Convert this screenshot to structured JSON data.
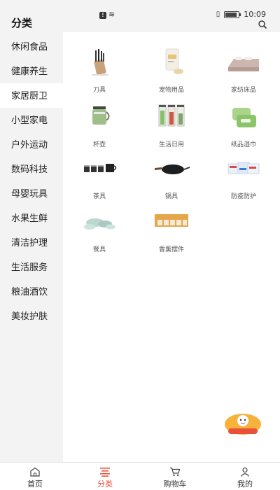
{
  "status_bar": {
    "time": "10:09"
  },
  "header": {
    "title": "分类"
  },
  "sidebar": {
    "items": [
      {
        "label": "休闲食品"
      },
      {
        "label": "健康养生"
      },
      {
        "label": "家居厨卫",
        "active": true
      },
      {
        "label": "小型家电"
      },
      {
        "label": "户外运动"
      },
      {
        "label": "数码科技"
      },
      {
        "label": "母婴玩具"
      },
      {
        "label": "水果生鲜"
      },
      {
        "label": "清洁护理"
      },
      {
        "label": "生活服务"
      },
      {
        "label": "粮油酒饮"
      },
      {
        "label": "美妆护肤"
      }
    ]
  },
  "categories": [
    {
      "label": "刀具",
      "icon": "knife-block-icon"
    },
    {
      "label": "宠物用品",
      "icon": "pet-food-bag-icon"
    },
    {
      "label": "家纺床品",
      "icon": "bed-icon"
    },
    {
      "label": "杯壶",
      "icon": "cup-kettle-icon"
    },
    {
      "label": "生活日用",
      "icon": "storage-jars-icon"
    },
    {
      "label": "纸品湿巾",
      "icon": "wet-wipes-icon"
    },
    {
      "label": "茶具",
      "icon": "tea-set-icon"
    },
    {
      "label": "锅具",
      "icon": "wok-icon"
    },
    {
      "label": "防疫防护",
      "icon": "masks-icon"
    },
    {
      "label": "餐具",
      "icon": "tableware-icon"
    },
    {
      "label": "香薰摆件",
      "icon": "candles-icon"
    }
  ],
  "bottom_nav": [
    {
      "label": "首页",
      "icon": "home-icon"
    },
    {
      "label": "分类",
      "icon": "category-list-icon",
      "active": true
    },
    {
      "label": "购物车",
      "icon": "cart-icon"
    },
    {
      "label": "我的",
      "icon": "user-icon"
    }
  ],
  "colors": {
    "accent": "#e8523b",
    "sidebar_bg": "#f3f3f3"
  }
}
